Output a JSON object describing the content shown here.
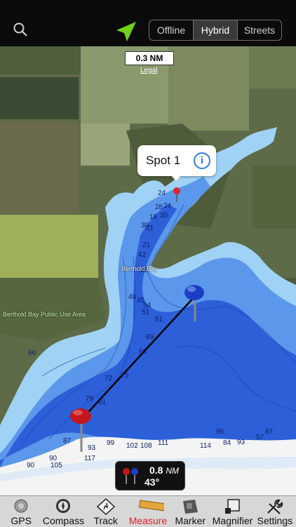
{
  "map_mode": {
    "options": [
      "Offline",
      "Hybrid",
      "Streets"
    ],
    "selected": "Hybrid"
  },
  "scale": {
    "label": "0.3 NM",
    "legal_link": "Legal"
  },
  "callout": {
    "title": "Spot 1"
  },
  "place_labels": {
    "bay": "Berthold Bay",
    "use_area": "Berthold Bay Public Use Area"
  },
  "measurement": {
    "distance_value": "0.8",
    "distance_unit": "NM",
    "bearing": "43°"
  },
  "depth_soundings": [
    "24",
    "28",
    "24",
    "18",
    "30",
    "21",
    "30",
    "21",
    "42",
    "48",
    "48",
    "45",
    "54",
    "51",
    "51",
    "63",
    "69",
    "72",
    "75",
    "78",
    "81",
    "87",
    "90",
    "93",
    "99",
    "102",
    "105",
    "108",
    "111",
    "117",
    "114",
    "84",
    "93",
    "96",
    "87",
    "57",
    "66",
    "90"
  ],
  "tabs": [
    {
      "label": "GPS",
      "icon": "gps-icon",
      "active": false
    },
    {
      "label": "Compass",
      "icon": "compass-icon",
      "active": false
    },
    {
      "label": "Track",
      "icon": "track-icon",
      "active": false
    },
    {
      "label": "Measure",
      "icon": "ruler-icon",
      "active": true
    },
    {
      "label": "Marker",
      "icon": "marker-icon",
      "active": false
    },
    {
      "label": "Magnifier",
      "icon": "magnifier-icon",
      "active": false
    },
    {
      "label": "Settings",
      "icon": "settings-icon",
      "active": false
    }
  ],
  "colors": {
    "active_tab": "#e0242f",
    "water_light": "#9fd2f5",
    "water_deep": "#2c5fd8",
    "pin_red": "#c3151c",
    "pin_blue": "#1a3fc7",
    "locate_green": "#6fd11b"
  }
}
